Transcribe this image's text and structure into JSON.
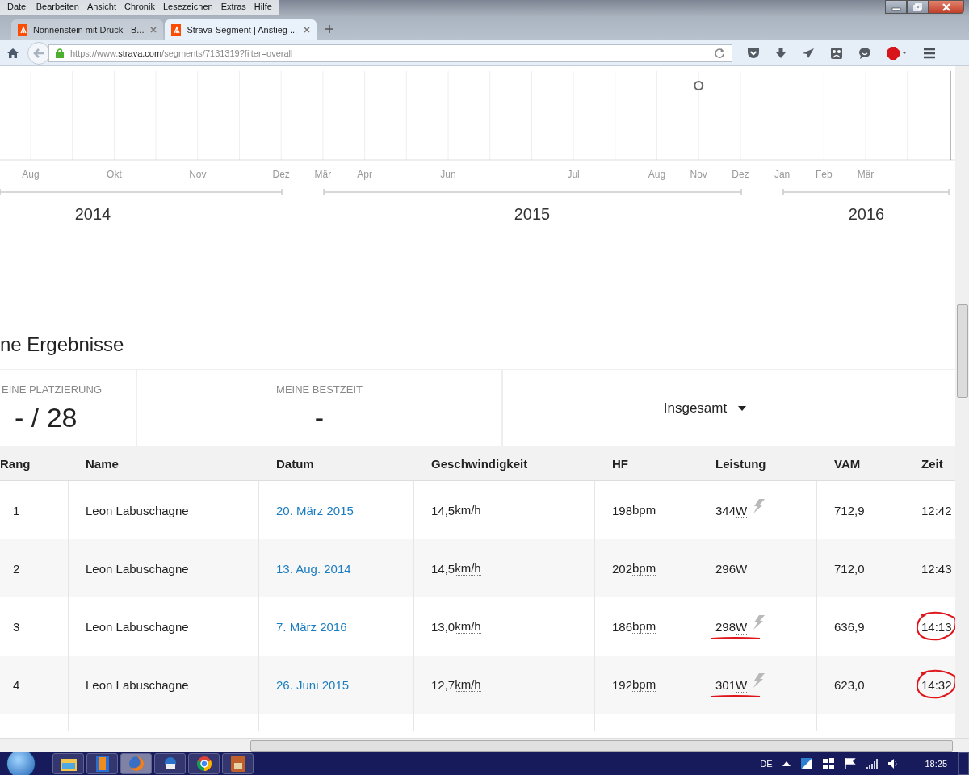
{
  "menu": [
    "Datei",
    "Bearbeiten",
    "Ansicht",
    "Chronik",
    "Lesezeichen",
    "Extras",
    "Hilfe"
  ],
  "tabs": [
    {
      "title": "Nonnenstein mit Druck - B...",
      "selected": false
    },
    {
      "title": "Strava-Segment | Anstieg ...",
      "selected": true
    }
  ],
  "address": {
    "prefix": "https://www.",
    "domain": "strava.com",
    "path": "/segments/7131319?filter=overall"
  },
  "timeline": {
    "months": [
      "Aug",
      "Okt",
      "Nov",
      "Dez",
      "Mär",
      "Apr",
      "Jun",
      "Jul",
      "Aug",
      "Nov",
      "Dez",
      "Jan",
      "Feb",
      "Mär"
    ],
    "years": [
      "2014",
      "2015",
      "2016"
    ]
  },
  "results": {
    "heading": "ne Ergebnisse",
    "stats": [
      {
        "label": "EINE PLATZIERUNG",
        "value": "- / 28"
      },
      {
        "label": "MEINE BESTZEIT",
        "value": "-"
      }
    ],
    "filter": "Insgesamt"
  },
  "table": {
    "columns": [
      "Rang",
      "Name",
      "Datum",
      "Geschwindigkeit",
      "HF",
      "Leistung",
      "VAM",
      "Zeit"
    ],
    "rows": [
      {
        "rank": "1",
        "name": "Leon Labuschagne",
        "date": "20. März 2015",
        "speed": "14,5",
        "speed_unit": "km/h",
        "hr": "198",
        "hr_unit": "bpm",
        "power": "344",
        "power_unit": "W",
        "measured": true,
        "underlined": false,
        "vam": "712,9",
        "time": "12:42",
        "circled": false
      },
      {
        "rank": "2",
        "name": "Leon Labuschagne",
        "date": "13. Aug. 2014",
        "speed": "14,5",
        "speed_unit": "km/h",
        "hr": "202",
        "hr_unit": "bpm",
        "power": "296",
        "power_unit": "W",
        "measured": false,
        "underlined": false,
        "vam": "712,0",
        "time": "12:43",
        "circled": false
      },
      {
        "rank": "3",
        "name": "Leon Labuschagne",
        "date": "7. März 2016",
        "speed": "13,0",
        "speed_unit": "km/h",
        "hr": "186",
        "hr_unit": "bpm",
        "power": "298",
        "power_unit": "W",
        "measured": true,
        "underlined": true,
        "vam": "636,9",
        "time": "14:13",
        "circled": true
      },
      {
        "rank": "4",
        "name": "Leon Labuschagne",
        "date": "26. Juni 2015",
        "speed": "12,7",
        "speed_unit": "km/h",
        "hr": "192",
        "hr_unit": "bpm",
        "power": "301",
        "power_unit": "W",
        "measured": true,
        "underlined": true,
        "vam": "623,0",
        "time": "14:32",
        "circled": true
      }
    ]
  },
  "taskbar": {
    "apps": [
      {
        "kind": "folder",
        "selected": false
      },
      {
        "kind": "film",
        "selected": false
      },
      {
        "kind": "firefox",
        "selected": true
      },
      {
        "kind": "mail",
        "selected": false
      },
      {
        "kind": "chrome",
        "selected": false
      },
      {
        "kind": "photo",
        "selected": false
      }
    ],
    "language": "DE",
    "clock": "18:25"
  }
}
